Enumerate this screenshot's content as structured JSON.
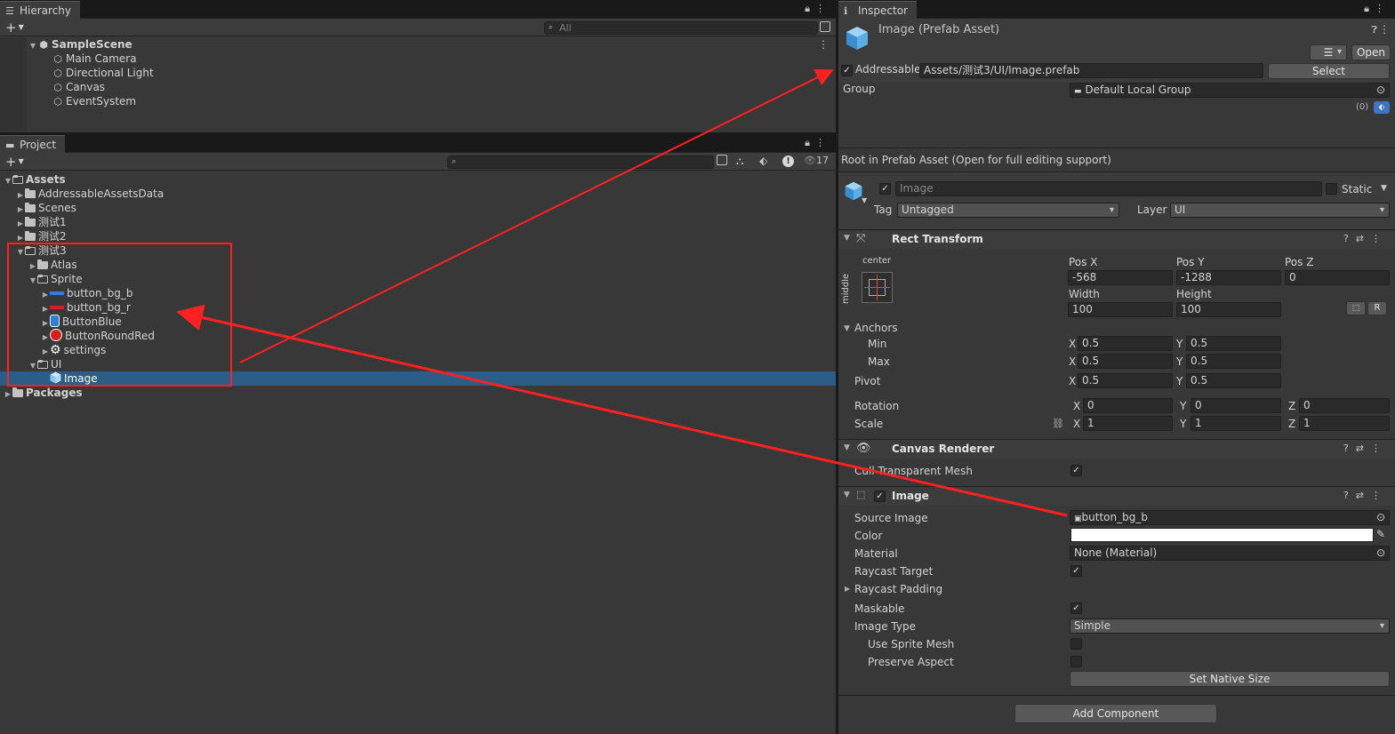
{
  "hierarchy": {
    "tab": "Hierarchy",
    "search_placeholder": "All",
    "scene": "SampleScene",
    "items": [
      "Main Camera",
      "Directional Light",
      "Canvas",
      "EventSystem"
    ]
  },
  "project": {
    "tab": "Project",
    "hidden_count": "17",
    "tree": [
      {
        "label": "Assets",
        "depth": 0,
        "open": true,
        "bold": true
      },
      {
        "label": "AddressableAssetsData",
        "depth": 1
      },
      {
        "label": "Scenes",
        "depth": 1
      },
      {
        "label": "测试1",
        "depth": 1
      },
      {
        "label": "测试2",
        "depth": 1
      },
      {
        "label": "测试3",
        "depth": 1,
        "open": true
      },
      {
        "label": "Atlas",
        "depth": 2
      },
      {
        "label": "Sprite",
        "depth": 2,
        "open": true
      },
      {
        "label": "button_bg_b",
        "depth": 3,
        "icon": "blue-bar"
      },
      {
        "label": "button_bg_r",
        "depth": 3,
        "icon": "red-bar"
      },
      {
        "label": "ButtonBlue",
        "depth": 3,
        "icon": "blue-button"
      },
      {
        "label": "ButtonRoundRed",
        "depth": 3,
        "icon": "red-circle"
      },
      {
        "label": "settings",
        "depth": 3,
        "icon": "gear"
      },
      {
        "label": "UI",
        "depth": 2,
        "open": true
      },
      {
        "label": "Image",
        "depth": 3,
        "icon": "prefab",
        "selected": true
      },
      {
        "label": "Packages",
        "depth": 0,
        "bold": true
      }
    ]
  },
  "inspector": {
    "tab": "Inspector",
    "asset_title": "Image (Prefab Asset)",
    "open_label": "Open",
    "addressable_label": "Addressable",
    "addressable_path": "Assets/测试3/UI/Image.prefab",
    "select_label": "Select",
    "group_label": "Group",
    "group_value": "Default Local Group",
    "label_count": "(0)",
    "root_note": "Root in Prefab Asset (Open for full editing support)",
    "object_name": "Image",
    "static_label": "Static",
    "tag_label": "Tag",
    "tag_value": "Untagged",
    "layer_label": "Layer",
    "layer_value": "UI",
    "rect_transform": {
      "title": "Rect Transform",
      "anchor_h": "center",
      "anchor_v": "middle",
      "pos_x_label": "Pos X",
      "pos_x": "-568",
      "pos_y_label": "Pos Y",
      "pos_y": "-1288",
      "pos_z_label": "Pos Z",
      "pos_z": "0",
      "width_label": "Width",
      "width": "100",
      "height_label": "Height",
      "height": "100",
      "r_label": "R",
      "anchors_label": "Anchors",
      "min_label": "Min",
      "min_x": "0.5",
      "min_y": "0.5",
      "max_label": "Max",
      "max_x": "0.5",
      "max_y": "0.5",
      "pivot_label": "Pivot",
      "pivot_x": "0.5",
      "pivot_y": "0.5",
      "rotation_label": "Rotation",
      "rot_x": "0",
      "rot_y": "0",
      "rot_z": "0",
      "scale_label": "Scale",
      "scale_x": "1",
      "scale_y": "1",
      "scale_z": "1",
      "x": "X",
      "y": "Y",
      "z": "Z"
    },
    "canvas_renderer": {
      "title": "Canvas Renderer",
      "cull_label": "Cull Transparent Mesh"
    },
    "image": {
      "title": "Image",
      "source_label": "Source Image",
      "source_value": "button_bg_b",
      "color_label": "Color",
      "material_label": "Material",
      "material_value": "None (Material)",
      "raycast_target_label": "Raycast Target",
      "raycast_padding_label": "Raycast Padding",
      "maskable_label": "Maskable",
      "image_type_label": "Image Type",
      "image_type_value": "Simple",
      "use_sprite_mesh_label": "Use Sprite Mesh",
      "preserve_aspect_label": "Preserve Aspect",
      "native_size_label": "Set Native Size"
    },
    "add_component_label": "Add Component"
  },
  "colors": {
    "selection": "#2c5d87",
    "annotation_red": "#ff2020",
    "color_swatch": "#ffffff"
  }
}
